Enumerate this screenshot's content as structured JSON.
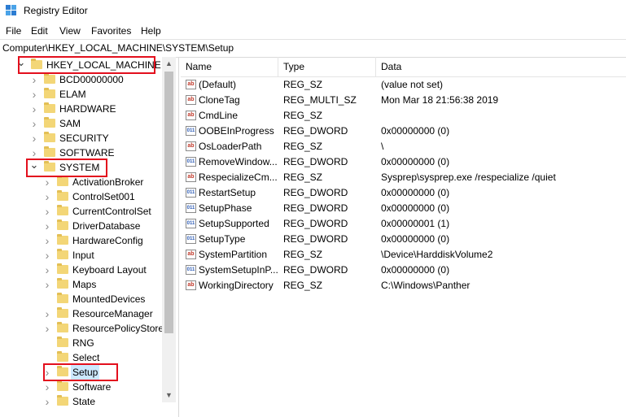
{
  "window": {
    "title": "Registry Editor"
  },
  "menu": [
    "File",
    "Edit",
    "View",
    "Favorites",
    "Help"
  ],
  "address": "Computer\\HKEY_LOCAL_MACHINE\\SYSTEM\\Setup",
  "tree": [
    {
      "label": "HKEY_LOCAL_MACHINE",
      "level": 0,
      "expanded": true
    },
    {
      "label": "BCD00000000",
      "level": 1
    },
    {
      "label": "ELAM",
      "level": 1
    },
    {
      "label": "HARDWARE",
      "level": 1
    },
    {
      "label": "SAM",
      "level": 1
    },
    {
      "label": "SECURITY",
      "level": 1
    },
    {
      "label": "SOFTWARE",
      "level": 1
    },
    {
      "label": "SYSTEM",
      "level": 1,
      "expanded": true
    },
    {
      "label": "ActivationBroker",
      "level": 2
    },
    {
      "label": "ControlSet001",
      "level": 2
    },
    {
      "label": "CurrentControlSet",
      "level": 2
    },
    {
      "label": "DriverDatabase",
      "level": 2
    },
    {
      "label": "HardwareConfig",
      "level": 2
    },
    {
      "label": "Input",
      "level": 2
    },
    {
      "label": "Keyboard Layout",
      "level": 2
    },
    {
      "label": "Maps",
      "level": 2
    },
    {
      "label": "MountedDevices",
      "level": 2,
      "leaf": true
    },
    {
      "label": "ResourceManager",
      "level": 2
    },
    {
      "label": "ResourcePolicyStore",
      "level": 2
    },
    {
      "label": "RNG",
      "level": 2,
      "leaf": true
    },
    {
      "label": "Select",
      "level": 2,
      "leaf": true
    },
    {
      "label": "Setup",
      "level": 2,
      "selected": true
    },
    {
      "label": "Software",
      "level": 2
    },
    {
      "label": "State",
      "level": 2
    }
  ],
  "columns": {
    "name": "Name",
    "type": "Type",
    "data": "Data"
  },
  "values": [
    {
      "name": "(Default)",
      "type": "REG_SZ",
      "data": "(value not set)",
      "icon": "string-value-icon"
    },
    {
      "name": "CloneTag",
      "type": "REG_MULTI_SZ",
      "data": "Mon Mar 18 21:56:38 2019",
      "icon": "string-value-icon"
    },
    {
      "name": "CmdLine",
      "type": "REG_SZ",
      "data": "",
      "icon": "string-value-icon"
    },
    {
      "name": "OOBEInProgress",
      "type": "REG_DWORD",
      "data": "0x00000000 (0)",
      "icon": "binary-value-icon"
    },
    {
      "name": "OsLoaderPath",
      "type": "REG_SZ",
      "data": "\\",
      "icon": "string-value-icon"
    },
    {
      "name": "RemoveWindow...",
      "type": "REG_DWORD",
      "data": "0x00000000 (0)",
      "icon": "binary-value-icon"
    },
    {
      "name": "RespecializeCm...",
      "type": "REG_SZ",
      "data": "Sysprep\\sysprep.exe /respecialize /quiet",
      "icon": "string-value-icon"
    },
    {
      "name": "RestartSetup",
      "type": "REG_DWORD",
      "data": "0x00000000 (0)",
      "icon": "binary-value-icon"
    },
    {
      "name": "SetupPhase",
      "type": "REG_DWORD",
      "data": "0x00000000 (0)",
      "icon": "binary-value-icon"
    },
    {
      "name": "SetupSupported",
      "type": "REG_DWORD",
      "data": "0x00000001 (1)",
      "icon": "binary-value-icon"
    },
    {
      "name": "SetupType",
      "type": "REG_DWORD",
      "data": "0x00000000 (0)",
      "icon": "binary-value-icon"
    },
    {
      "name": "SystemPartition",
      "type": "REG_SZ",
      "data": "\\Device\\HarddiskVolume2",
      "icon": "string-value-icon"
    },
    {
      "name": "SystemSetupInP...",
      "type": "REG_DWORD",
      "data": "0x00000000 (0)",
      "icon": "binary-value-icon"
    },
    {
      "name": "WorkingDirectory",
      "type": "REG_SZ",
      "data": "C:\\Windows\\Panther",
      "icon": "string-value-icon"
    }
  ],
  "colors": {
    "highlight_box": "#e30f1d",
    "selection": "#cce8ff",
    "folder": "#f3d677"
  }
}
